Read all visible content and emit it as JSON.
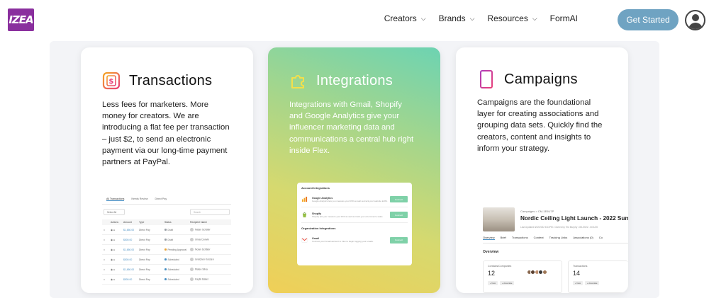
{
  "nav": {
    "logo_text": "IZEA",
    "links": [
      {
        "label": "Creators",
        "has_dropdown": true
      },
      {
        "label": "Brands",
        "has_dropdown": true
      },
      {
        "label": "Resources",
        "has_dropdown": true
      },
      {
        "label": "FormAI",
        "has_dropdown": false
      }
    ],
    "cta_label": "Get Started",
    "cta_color": "#6fa3c2",
    "avatar_icon": "user-circle-icon"
  },
  "cards": [
    {
      "title": "Transactions",
      "icon": "dollar-receipt-icon",
      "description": "Less fees for marketers. More money for creators. We are introducing a flat fee per transaction – just $2, to send an electronic payment via our long-time payment partners at PayPal.",
      "accent": "#e8407a"
    },
    {
      "title": "Integrations",
      "icon": "puzzle-piece-icon",
      "description": "Integrations with Gmail, Shopify and Google Analytics give your influencer marketing data and communications a central hub right inside Flex.",
      "accent": "#ffffff"
    },
    {
      "title": "Campaigns",
      "icon": "notebook-icon",
      "description": "Campaigns are the foundational layer for creating associations and grouping data sets. Quickly find the creators, content and insights to inform your strategy.",
      "accent": "#8a2f9e"
    }
  ],
  "transactions_preview": {
    "tabs": [
      "All Transactions",
      "Needs Review",
      "Direct Pay"
    ],
    "select_all": "Select All",
    "search_placeholder": "Search",
    "headers": [
      "Actions",
      "Amount",
      "Type",
      "Status",
      "Recipient Name"
    ],
    "rows": [
      {
        "amount": "$1,650.00",
        "type": "Direct Pay",
        "status": "Draft",
        "status_color": "#9aa0a6",
        "name": "Natan Schäfer"
      },
      {
        "amount": "$500.00",
        "type": "Direct Pay",
        "status": "Draft",
        "status_color": "#9aa0a6",
        "name": "Omar Dorwin"
      },
      {
        "amount": "$1,650.00",
        "type": "Direct Pay",
        "status": "Pending Approval",
        "status_color": "#e8a33a",
        "name": "Nolan Schäfer"
      },
      {
        "amount": "$500.00",
        "type": "Direct Pay",
        "status": "Scheduled",
        "status_color": "#4a90c4",
        "name": "Gretchen Korsten"
      },
      {
        "amount": "$1,650.00",
        "type": "Direct Pay",
        "status": "Scheduled",
        "status_color": "#4a90c4",
        "name": "Mateo Silva"
      },
      {
        "amount": "$500.00",
        "type": "Direct Pay",
        "status": "Scheduled",
        "status_color": "#4a90c4",
        "name": "Kaylin Baker"
      }
    ]
  },
  "integrations_preview": {
    "account_heading": "Account Integrations",
    "org_heading": "Organization Integrations",
    "items": [
      {
        "name": "Google Analytics",
        "desc": "Google Analytics lets you measure your ROI as well as track your website traffic.",
        "button": "Connect",
        "icon": "google-analytics-icon"
      },
      {
        "name": "Shopify",
        "desc": "Shopify lets you measure your ROI as well as track your eCommerce sales.",
        "button": "Connect",
        "icon": "shopify-icon"
      },
      {
        "name": "Gmail",
        "desc": "Connect your Gmail account to Flex to begin logging your emails.",
        "button": "Connect",
        "icon": "gmail-icon"
      }
    ]
  },
  "campaigns_preview": {
    "breadcrumb": "Campaigns > CM-1E6U7P",
    "title": "Nordic Ceiling Light Launch - 2022 Summ",
    "meta": "Last Updated 8/22/2022 8:11PM • Owned by Ted Murphy • 8/1/2022 - 8/31/20",
    "tabs": [
      "Overview",
      "Brief",
      "Transactions",
      "Content",
      "Tracking Links",
      "Associations (0)",
      "Co"
    ],
    "overview_label": "Overview",
    "contacts_label": "Contacts/Companies",
    "contacts_count": "12",
    "transactions_label": "Transactions",
    "transactions_count": "14",
    "tag_new": "+ New",
    "tag_associate": "+ Associate"
  }
}
